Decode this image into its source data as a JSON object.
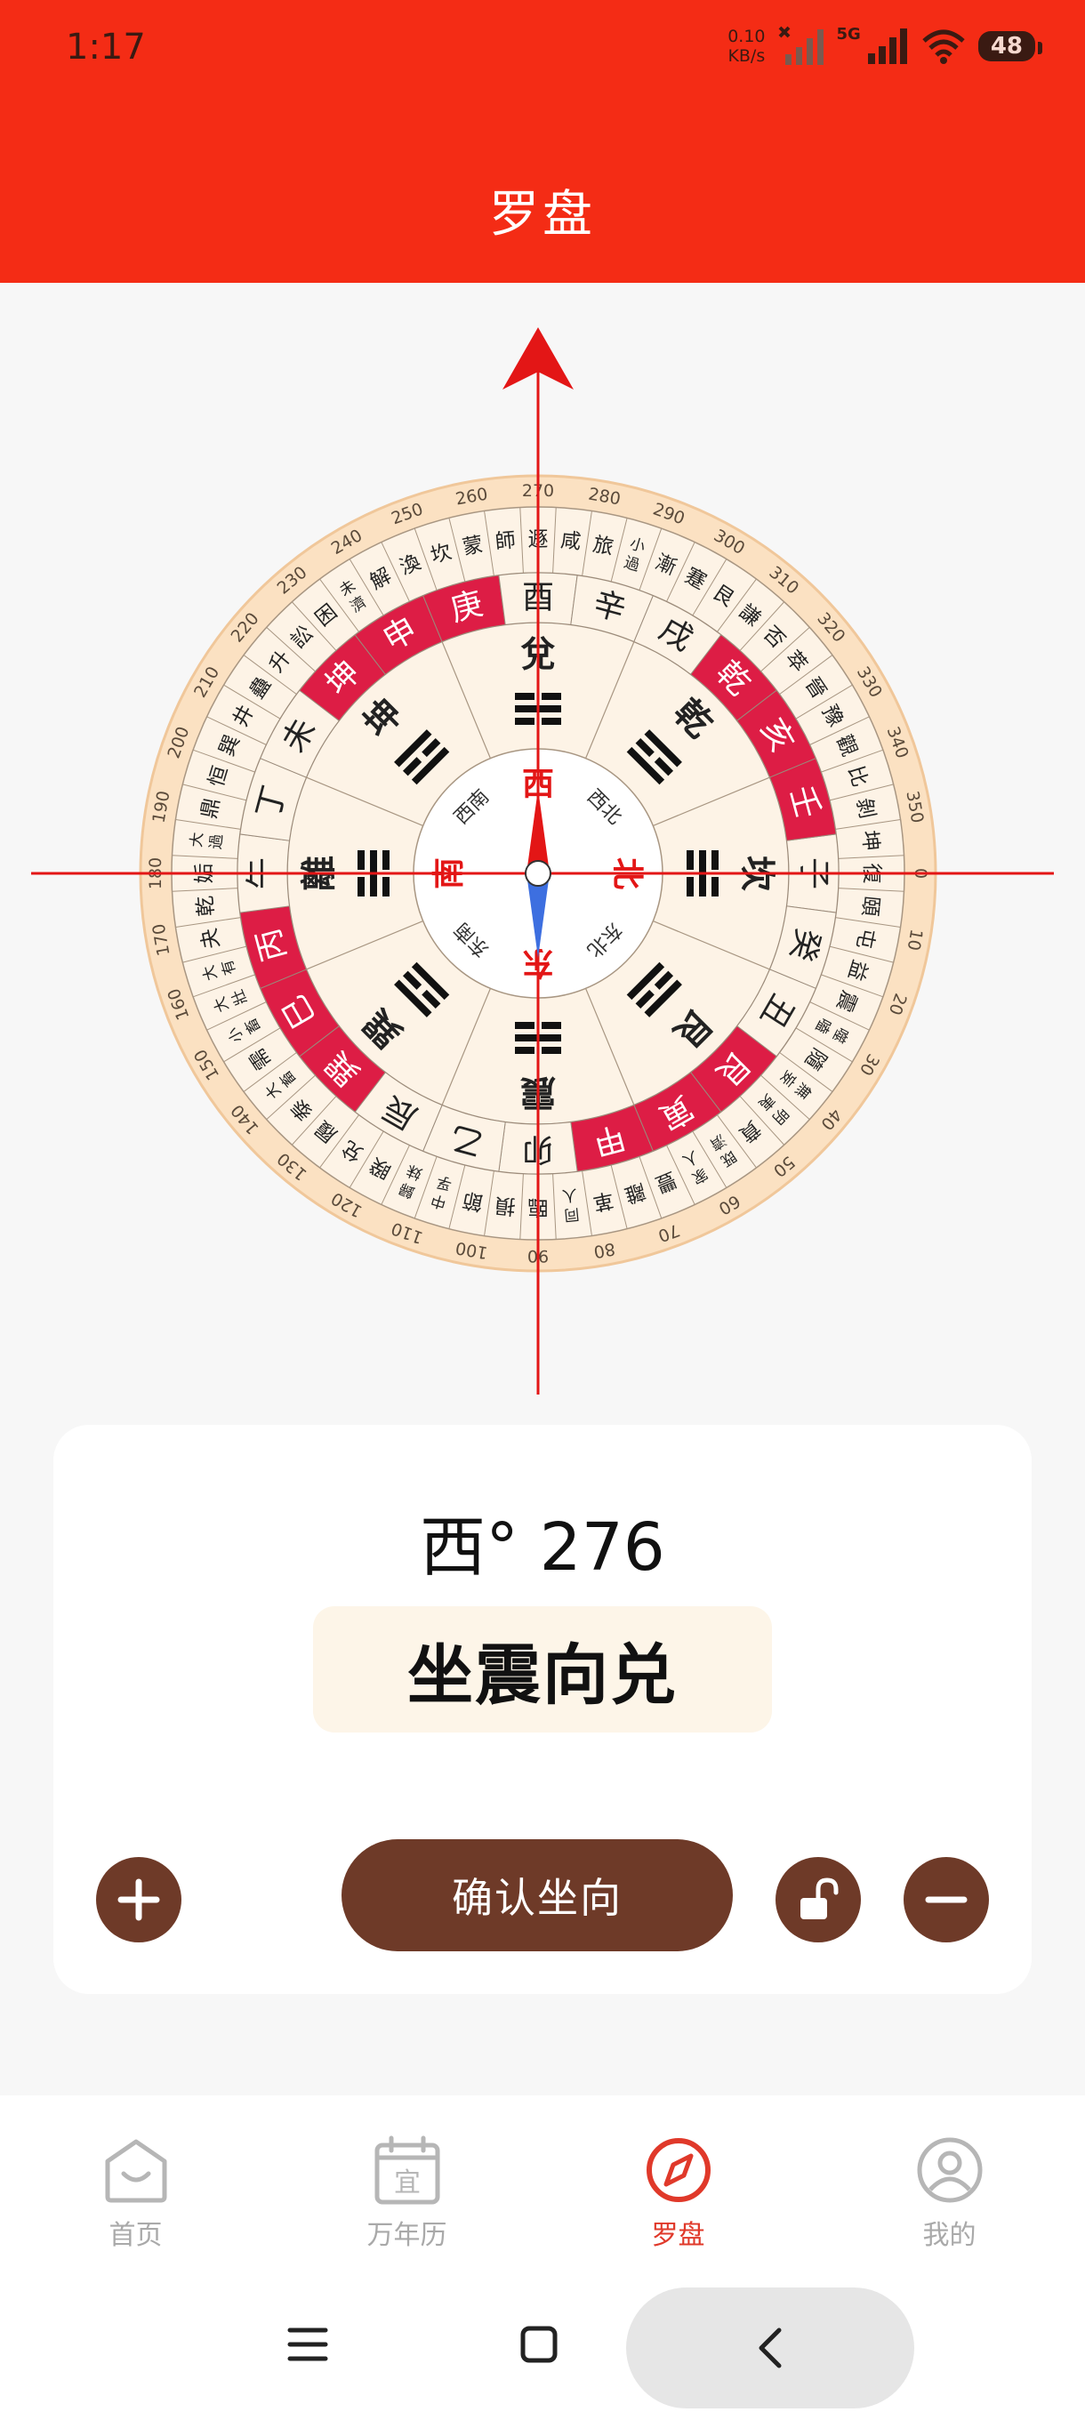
{
  "status_bar": {
    "time": "1:17",
    "speed_value": "0.10",
    "speed_unit": "KB/s",
    "network": "5G",
    "battery": "48"
  },
  "header": {
    "title": "罗盘"
  },
  "compass": {
    "heading_deg": 276,
    "degree_labels": [
      "0",
      "10",
      "20",
      "30",
      "40",
      "50",
      "60",
      "70",
      "80",
      "90",
      "100",
      "110",
      "120",
      "130",
      "140",
      "150",
      "160",
      "170",
      "180",
      "190",
      "200",
      "210",
      "220",
      "230",
      "240",
      "250",
      "260",
      "270",
      "280",
      "290",
      "300",
      "310",
      "320",
      "330",
      "340",
      "350"
    ],
    "hexagrams": [
      "復",
      "頤",
      "屯",
      "益",
      "震",
      "噬嗑",
      "隨",
      "無妄",
      "明夷",
      "賁",
      "既濟",
      "家人",
      "豐",
      "離",
      "革",
      "同人",
      "臨",
      "損",
      "節",
      "中孚",
      "歸妹",
      "睽",
      "兌",
      "履",
      "泰",
      "大畜",
      "需",
      "小畜",
      "大壯",
      "大有",
      "夬",
      "乾",
      "姤",
      "大過",
      "鼎",
      "恒",
      "巽",
      "井",
      "蠱",
      "升",
      "訟",
      "困",
      "未濟",
      "解",
      "渙",
      "坎",
      "蒙",
      "師",
      "遯",
      "咸",
      "旅",
      "小過",
      "漸",
      "蹇",
      "艮",
      "謙",
      "否",
      "萃",
      "晉",
      "豫",
      "觀",
      "比",
      "剝",
      "坤"
    ],
    "mountains": [
      "子",
      "癸",
      "丑",
      "艮",
      "寅",
      "甲",
      "卯",
      "乙",
      "辰",
      "巽",
      "巳",
      "丙",
      "午",
      "丁",
      "未",
      "坤",
      "申",
      "庚",
      "酉",
      "辛",
      "戌",
      "乾",
      "亥",
      "壬"
    ],
    "highlighted_mountains": [
      "艮",
      "寅",
      "甲",
      "巽",
      "巳",
      "丙",
      "坤",
      "申",
      "庚",
      "乾",
      "亥",
      "壬"
    ],
    "trigrams": [
      "坎",
      "艮",
      "震",
      "巽",
      "離",
      "坤",
      "兌",
      "乾"
    ],
    "directions": [
      "北",
      "东北",
      "东",
      "东南",
      "南",
      "西南",
      "西",
      "西北"
    ],
    "colors": {
      "highlight": "#dd1d45",
      "ring": "#fdebd6",
      "inner_face": "#ffffff",
      "cross": "#e31616"
    }
  },
  "card": {
    "reading": "西° 276",
    "sitting_facing": "坐震向兑",
    "confirm_label": "确认坐向"
  },
  "nav": {
    "items": [
      {
        "label": "首页",
        "icon": "home-icon"
      },
      {
        "label": "万年历",
        "icon": "calendar-icon"
      },
      {
        "label": "罗盘",
        "icon": "compass-icon",
        "active": true
      },
      {
        "label": "我的",
        "icon": "user-icon"
      }
    ],
    "calendar_glyph": "宜"
  }
}
